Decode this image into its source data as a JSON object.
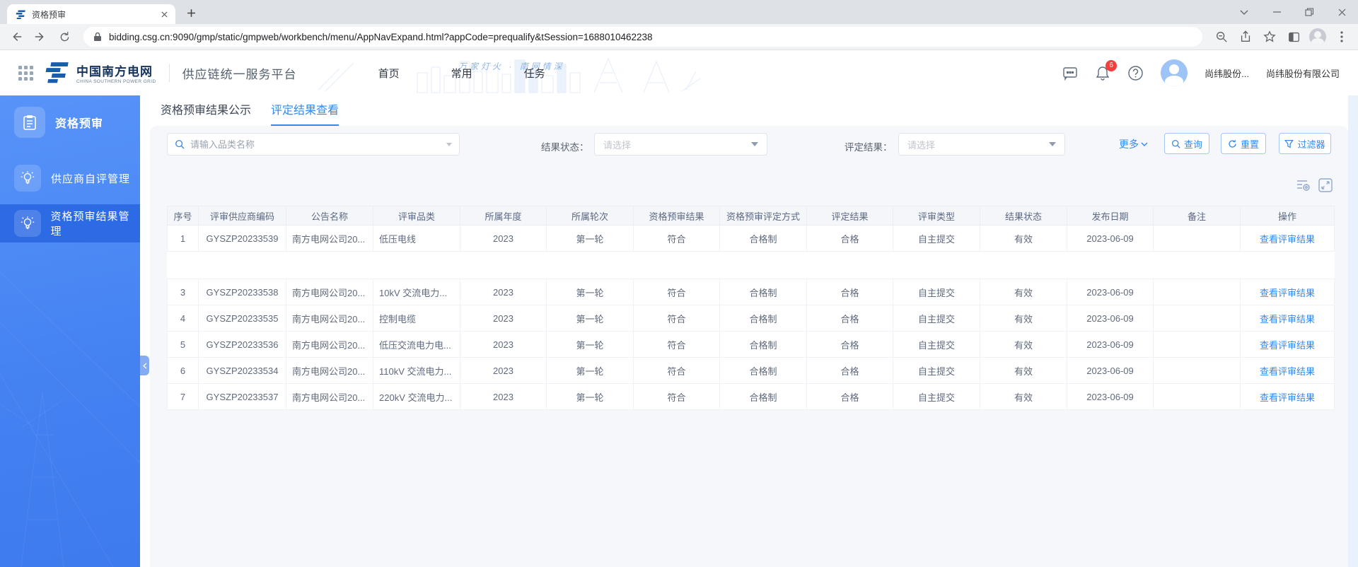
{
  "browser": {
    "tab_title": "资格预审",
    "url": "bidding.csg.cn:9090/gmp/static/gmpweb/workbench/menu/AppNavExpand.html?appCode=prequalify&tSession=1688010462238"
  },
  "header": {
    "logo_cn": "中国南方电网",
    "logo_en": "CHINA SOUTHERN POWER GRID",
    "platform_title": "供应链统一服务平台",
    "nav": [
      "首页",
      "常用",
      "任务"
    ],
    "watermark": "万家灯火 · 南网情深",
    "notification_count": "6",
    "user_name_short": "尚纬股份...",
    "company_name": "尚纬股份有限公司"
  },
  "sidebar": {
    "items": [
      {
        "label": "资格预审",
        "active": false
      },
      {
        "label": "供应商自评管理",
        "active": false
      },
      {
        "label": "资格预审结果管理",
        "active": true
      }
    ]
  },
  "tabs": [
    {
      "label": "资格预审结果公示",
      "active": false
    },
    {
      "label": "评定结果查看",
      "active": true
    }
  ],
  "filters": {
    "search_placeholder": "请输入品类名称",
    "result_status_label": "结果状态：",
    "result_status_value": "请选择",
    "evaluation_result_label": "评定结果：",
    "evaluation_result_value": "请选择",
    "more_label": "更多",
    "query_button": "查询",
    "reset_button": "重置",
    "filter_button": "过滤器"
  },
  "table": {
    "columns": [
      "序号",
      "评审供应商编码",
      "公告名称",
      "评审品类",
      "所属年度",
      "所属轮次",
      "资格预审结果",
      "资格预审评定方式",
      "评定结果",
      "评审类型",
      "结果状态",
      "发布日期",
      "备注",
      "操作"
    ],
    "action_label": "查看评审结果",
    "rows": [
      {
        "blank": false,
        "cells": [
          "1",
          "GYSZP20233539",
          "南方电网公司20...",
          "低压电线",
          "2023",
          "第一轮",
          "符合",
          "合格制",
          "合格",
          "自主提交",
          "有效",
          "2023-06-09",
          ""
        ]
      },
      {
        "blank": true,
        "cells": []
      },
      {
        "blank": false,
        "cells": [
          "3",
          "GYSZP20233538",
          "南方电网公司20...",
          "10kV 交流电力...",
          "2023",
          "第一轮",
          "符合",
          "合格制",
          "合格",
          "自主提交",
          "有效",
          "2023-06-09",
          ""
        ]
      },
      {
        "blank": false,
        "cells": [
          "4",
          "GYSZP20233535",
          "南方电网公司20...",
          "控制电缆",
          "2023",
          "第一轮",
          "符合",
          "合格制",
          "合格",
          "自主提交",
          "有效",
          "2023-06-09",
          ""
        ]
      },
      {
        "blank": false,
        "cells": [
          "5",
          "GYSZP20233536",
          "南方电网公司20...",
          "低压交流电力电...",
          "2023",
          "第一轮",
          "符合",
          "合格制",
          "合格",
          "自主提交",
          "有效",
          "2023-06-09",
          ""
        ]
      },
      {
        "blank": false,
        "cells": [
          "6",
          "GYSZP20233534",
          "南方电网公司20...",
          "110kV 交流电力...",
          "2023",
          "第一轮",
          "符合",
          "合格制",
          "合格",
          "自主提交",
          "有效",
          "2023-06-09",
          ""
        ]
      },
      {
        "blank": false,
        "cells": [
          "7",
          "GYSZP20233537",
          "南方电网公司20...",
          "220kV 交流电力...",
          "2023",
          "第一轮",
          "符合",
          "合格制",
          "合格",
          "自主提交",
          "有效",
          "2023-06-09",
          ""
        ]
      }
    ]
  },
  "colors": {
    "accent": "#3388EE",
    "sidebar_top": "#5793F8",
    "sidebar_bottom": "#3D7BEE",
    "sidebar_active": "#2D6BE4",
    "badge": "#F53F3F",
    "link": "#3388EE"
  }
}
